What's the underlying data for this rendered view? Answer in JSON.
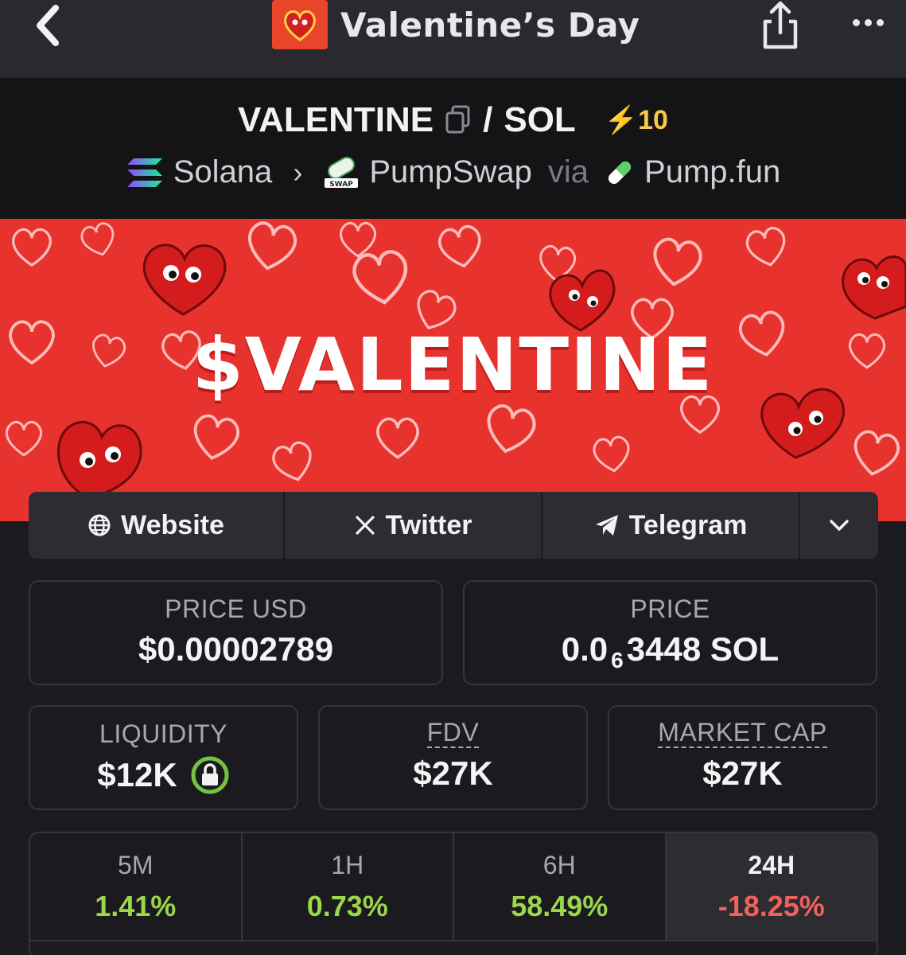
{
  "nav": {
    "title": "Valentine’s Day",
    "back_icon": "chevron-left-icon",
    "share_icon": "share-icon",
    "more_icon": "more-icon"
  },
  "pair": {
    "base": "VALENTINE",
    "separator": "/",
    "quote": "SOL",
    "boost": "⚡10",
    "chain": "Solana",
    "dex": "PumpSwap",
    "via": "via",
    "launchpad": "Pump.fun"
  },
  "banner": {
    "title": "$VALENTINE"
  },
  "social": {
    "website": "Website",
    "twitter": "Twitter",
    "telegram": "Telegram"
  },
  "stats": {
    "price_usd_label": "PRICE USD",
    "price_usd_value": "$0.00002789",
    "price_label": "PRICE",
    "price_prefix": "0.0",
    "price_sub": "6",
    "price_suffix": "3448 SOL",
    "liquidity_label": "LIQUIDITY",
    "liquidity_value": "$12K",
    "fdv_label": "FDV",
    "fdv_value": "$27K",
    "mcap_label": "MARKET CAP",
    "mcap_value": "$27K"
  },
  "timeframes": [
    {
      "label": "5M",
      "value": "1.41%"
    },
    {
      "label": "1H",
      "value": "0.73%"
    },
    {
      "label": "6H",
      "value": "58.49%"
    },
    {
      "label": "24H",
      "value": "-18.25%"
    }
  ],
  "colors": {
    "positive": "#9cd64b",
    "negative": "#f0605c",
    "boost": "#f7c948",
    "banner": "#e8322e"
  }
}
